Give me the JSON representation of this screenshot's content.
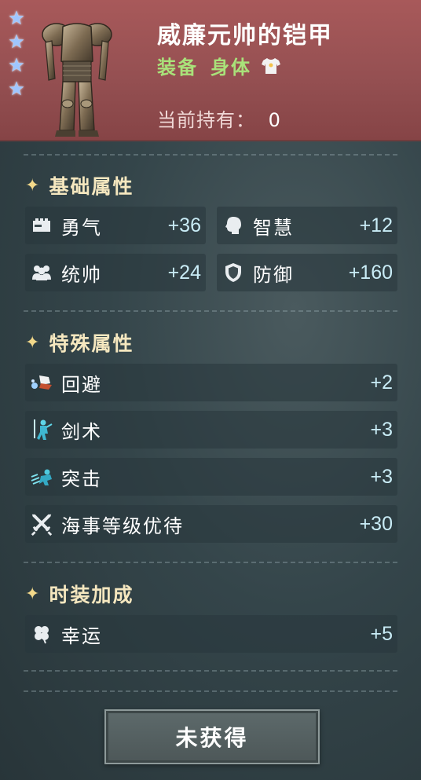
{
  "item": {
    "name": "威廉元帅的铠甲",
    "category": "装备",
    "slot": "身体",
    "owned_label": "当前持有：",
    "owned_value": "0",
    "stars": 4
  },
  "sections": {
    "basic": {
      "title": "基础属性"
    },
    "special": {
      "title": "特殊属性"
    },
    "fashion": {
      "title": "时装加成"
    }
  },
  "basic_stats": [
    {
      "icon": "courage-icon",
      "label": "勇气",
      "value": "+36"
    },
    {
      "icon": "wisdom-icon",
      "label": "智慧",
      "value": "+12"
    },
    {
      "icon": "command-icon",
      "label": "统帅",
      "value": "+24"
    },
    {
      "icon": "defense-shield-icon",
      "label": "防御",
      "value": "+160"
    }
  ],
  "special_stats": [
    {
      "icon": "dodge-icon",
      "label": "回避",
      "value": "+2"
    },
    {
      "icon": "swordsmanship-icon",
      "label": "剑术",
      "value": "+3"
    },
    {
      "icon": "charge-icon",
      "label": "突击",
      "value": "+3"
    },
    {
      "icon": "crossed-swords-icon",
      "label": "海事等级优待",
      "value": "+30"
    }
  ],
  "fashion_stats": [
    {
      "icon": "clover-icon",
      "label": "幸运",
      "value": "+5"
    }
  ],
  "button": {
    "label": "未获得"
  },
  "colors": {
    "header_bg": "#a8595a",
    "type_green": "#a9e27a",
    "section_gold": "#f5e7bf",
    "value_cyan": "#c9ecf6",
    "star_blue": "#9fc6ff"
  }
}
